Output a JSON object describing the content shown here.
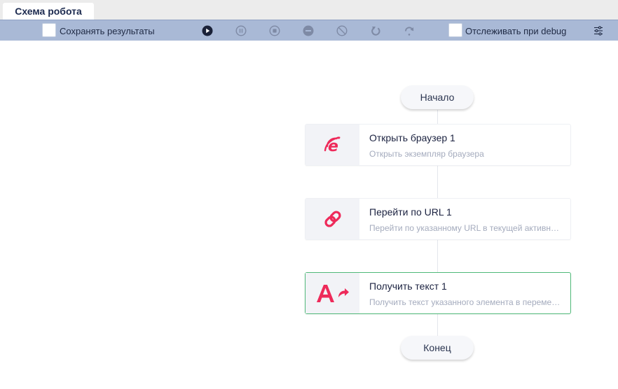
{
  "tab": {
    "title": "Схема робота"
  },
  "toolbar": {
    "save_results_label": "Сохранять результаты",
    "track_debug_label": "Отслеживать при debug",
    "buttons": [
      {
        "name": "run",
        "icon": "play-icon"
      },
      {
        "name": "pause",
        "icon": "pause-icon"
      },
      {
        "name": "stop",
        "icon": "stop-icon"
      },
      {
        "name": "disable",
        "icon": "minus-icon"
      },
      {
        "name": "block",
        "icon": "cancel-icon"
      },
      {
        "name": "undo",
        "icon": "undo-icon"
      },
      {
        "name": "redo",
        "icon": "redo-icon"
      }
    ],
    "settings_icon": "sliders-icon"
  },
  "flow": {
    "start_label": "Начало",
    "end_label": "Конец",
    "nodes": [
      {
        "title": "Открыть браузер  1",
        "subtitle": "Открыть экземпляр браузера",
        "icon": "browser-e-icon",
        "selected": false
      },
      {
        "title": "Перейти по URL  1",
        "subtitle": "Перейти по указанному URL в текущей активной вкладке",
        "icon": "link-icon",
        "selected": false
      },
      {
        "title": "Получить текст  1",
        "subtitle": "Получить текст указанного элемента в переменную",
        "icon": "get-text-icon",
        "selected": true
      }
    ]
  },
  "colors": {
    "accent_red": "#ee2a5a",
    "toolbar_bg": "#a9b9d6",
    "selected_border": "#4fb878"
  }
}
